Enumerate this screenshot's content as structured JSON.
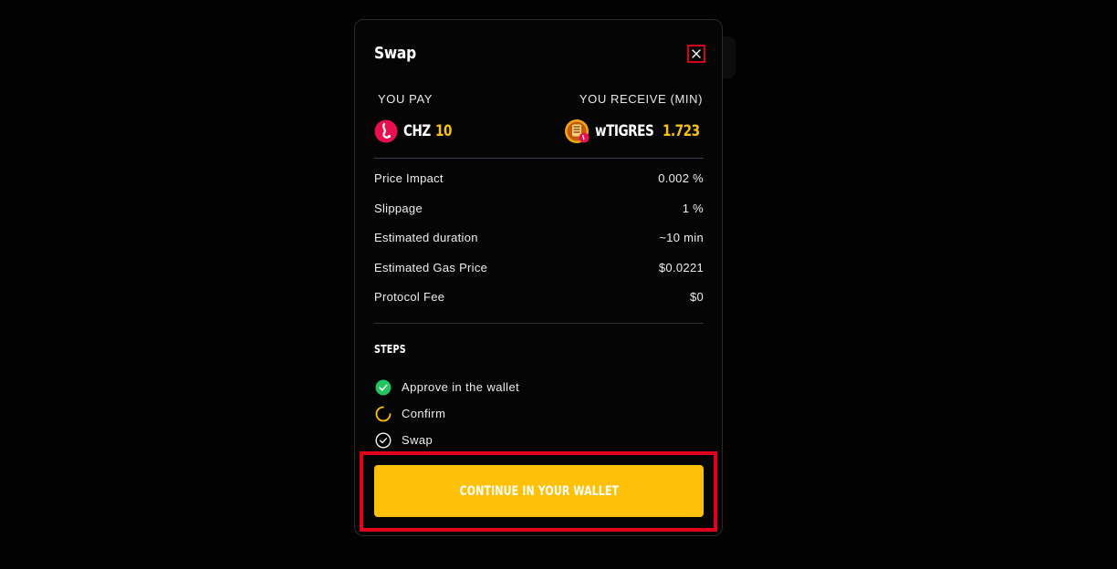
{
  "modal": {
    "title": "Swap",
    "close_icon": "close-icon"
  },
  "pay": {
    "label": "YOU PAY",
    "token": "CHZ",
    "amount": "10",
    "icon": "chz-token-icon",
    "icon_color": "#e8114f"
  },
  "receive": {
    "label": "YOU RECEIVE (MIN)",
    "token": "wTIGRES",
    "amount": "1.723",
    "icon": "tigres-token-icon"
  },
  "details": [
    {
      "label": "Price Impact",
      "value": "0.002 %"
    },
    {
      "label": "Slippage",
      "value": "1 %"
    },
    {
      "label": "Estimated duration",
      "value": "~10 min"
    },
    {
      "label": "Estimated Gas Price",
      "value": "$0.0221"
    },
    {
      "label": "Protocol Fee",
      "value": "$0"
    }
  ],
  "steps": {
    "title": "STEPS",
    "items": [
      {
        "label": "Approve in the wallet",
        "status": "complete",
        "icon": "check-circle-icon"
      },
      {
        "label": "Confirm",
        "status": "in-progress",
        "icon": "spinner-icon"
      },
      {
        "label": "Swap",
        "status": "pending",
        "icon": "check-outline-icon"
      }
    ]
  },
  "cta": {
    "label": "CONTINUE IN YOUR WALLET"
  },
  "colors": {
    "accent": "#ffc107",
    "amount": "#f8c30a",
    "success": "#22c55e",
    "highlight": "#e3001b",
    "background": "#050505"
  }
}
